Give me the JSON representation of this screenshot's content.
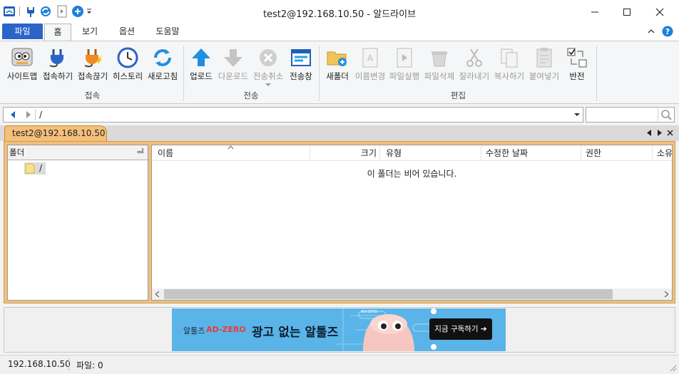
{
  "window": {
    "title": "test2@192.168.10.50 - 알드라이브"
  },
  "ribbon_tabs": {
    "file": "파일",
    "home": "홈",
    "view": "보기",
    "options": "옵션",
    "help": "도움말"
  },
  "ribbon": {
    "connect_group": {
      "label": "접속",
      "buttons": [
        "사이트맵",
        "접속하기",
        "접속끊기",
        "히스토리",
        "새로고침"
      ]
    },
    "transfer_group": {
      "label": "전송",
      "buttons": [
        "업로드",
        "다운로드",
        "전송취소",
        "전송창"
      ]
    },
    "edit_group": {
      "label": "편집",
      "buttons": [
        "새폴더",
        "이름변경",
        "파일실행",
        "파일삭제",
        "잘라내기",
        "복사하기",
        "붙여넣기",
        "반전"
      ]
    }
  },
  "address": {
    "path": "/",
    "search_placeholder": ""
  },
  "session": {
    "tab_label": "test2@192.168.10.50"
  },
  "folder_pane": {
    "title": "폴더",
    "pin": "ᆗ",
    "root": "/"
  },
  "file_list": {
    "columns": [
      "이름",
      "크기",
      "유형",
      "수정한 날짜",
      "권한",
      "소유"
    ],
    "empty_message": "이 폴더는 비어 있습니다."
  },
  "ad": {
    "brand": "알툴즈",
    "product": "AD-ZERO",
    "headline": "광고 없는 알툴즈",
    "cta": "지금 구독하기 ➔",
    "tag": "AD-ZERO"
  },
  "status": {
    "host": "192.168.10.50",
    "files": "파일: 0"
  },
  "colors": {
    "accent": "#2a64c8",
    "session_tab": "#f4c07a",
    "ad_bg": "#5ab4e8"
  }
}
